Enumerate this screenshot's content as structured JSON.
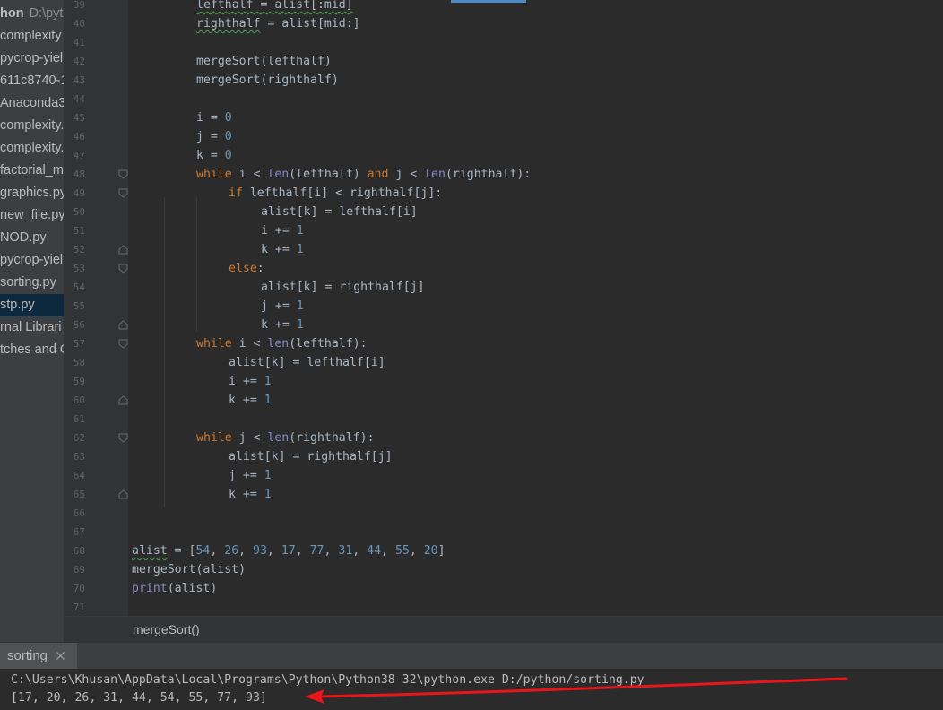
{
  "project_tree": {
    "root_name": "hon",
    "root_path": "D:\\pyt",
    "items": [
      "complexity",
      "pycrop-yiel",
      "611c8740-1",
      "Anaconda3",
      "complexity.",
      "complexity.",
      "factorial_m",
      "graphics.py",
      "new_file.py",
      "NOD.py",
      "pycrop-yiel",
      "sorting.py",
      "stp.py",
      "rnal Librari",
      "tches and C"
    ],
    "selected_index": 12
  },
  "editor": {
    "line_numbers": [
      "39",
      "40",
      "41",
      "42",
      "43",
      "44",
      "45",
      "46",
      "47",
      "48",
      "49",
      "50",
      "51",
      "52",
      "53",
      "54",
      "55",
      "56",
      "57",
      "58",
      "59",
      "60",
      "61",
      "62",
      "63",
      "64",
      "65",
      "66",
      "67",
      "68",
      "69",
      "70",
      "71"
    ],
    "lines": [
      "lefthalf = alist[:mid]",
      "righthalf = alist[mid:]",
      "",
      "mergeSort(lefthalf)",
      "mergeSort(righthalf)",
      "",
      "i = 0",
      "j = 0",
      "k = 0",
      "while i < len(lefthalf) and j < len(righthalf):",
      "if lefthalf[i] < righthalf[j]:",
      "alist[k] = lefthalf[i]",
      "i += 1",
      "k += 1",
      "else:",
      "alist[k] = righthalf[j]",
      "j += 1",
      "k += 1",
      "while i < len(lefthalf):",
      "alist[k] = lefthalf[i]",
      "i += 1",
      "k += 1",
      "",
      "while j < len(righthalf):",
      "alist[k] = righthalf[j]",
      "j += 1",
      "k += 1",
      "",
      "",
      "alist = [54, 26, 93, 17, 77, 31, 44, 55, 20]",
      "mergeSort(alist)",
      "print(alist)",
      ""
    ]
  },
  "breadcrumb": {
    "label": "mergeSort()"
  },
  "run_panel": {
    "tab_label": "sorting",
    "command": "C:\\Users\\Khusan\\AppData\\Local\\Programs\\Python\\Python38-32\\python.exe D:/python/sorting.py",
    "output": "[17, 20, 26, 31, 44, 54, 55, 77, 93]"
  },
  "colors": {
    "keyword": "#cc7832",
    "number": "#6897bb",
    "builtin": "#8888c6",
    "text": "#a9b7c6",
    "arrow": "#e8151b"
  }
}
